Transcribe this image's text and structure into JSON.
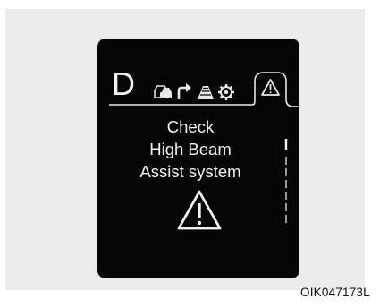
{
  "cluster": {
    "gear_indicator": "D",
    "tabs": [
      {
        "icon": "vehicle-info-icon"
      },
      {
        "icon": "navigation-turn-icon"
      },
      {
        "icon": "driving-assist-road-icon"
      },
      {
        "icon": "settings-gear-icon"
      },
      {
        "icon": "warning-triangle-icon",
        "active": true
      }
    ],
    "message": {
      "line1": "Check",
      "line2": "High Beam",
      "line3": "Assist system",
      "icon": "warning-triangle-icon"
    },
    "scroll": {
      "position": "top"
    }
  },
  "figure_code": "OIK047173L",
  "colors": {
    "screen": "#060606",
    "text": "#f2f2f2",
    "panel": "#ebebeb"
  }
}
